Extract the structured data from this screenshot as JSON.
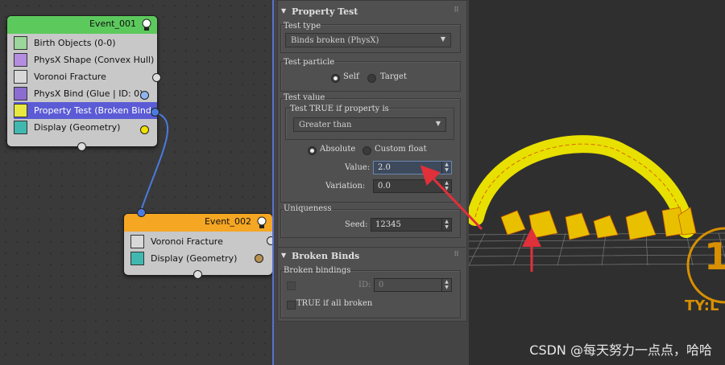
{
  "event1": {
    "title": "Event_001",
    "operators": [
      {
        "label": "Birth Objects (0-0)",
        "icon": "birth-objects-icon"
      },
      {
        "label": "PhysX Shape (Convex Hull)",
        "icon": "physx-shape-icon"
      },
      {
        "label": "Voronoi Fracture",
        "icon": "voronoi-fracture-icon"
      },
      {
        "label": "PhysX Bind (Glue | ID: 0)",
        "icon": "physx-bind-icon"
      },
      {
        "label": "Property Test (Broken Bind...",
        "icon": "property-test-icon"
      },
      {
        "label": "Display (Geometry)",
        "icon": "display-geometry-icon"
      }
    ]
  },
  "event2": {
    "title": "Event_002",
    "operators": [
      {
        "label": "Voronoi Fracture",
        "icon": "voronoi-fracture-icon"
      },
      {
        "label": "Display (Geometry)",
        "icon": "display-geometry-icon"
      }
    ]
  },
  "panel": {
    "rollout1": "Property Test",
    "test_type_label": "Test type",
    "test_type_value": "Binds broken (PhysX)",
    "test_particle_label": "Test particle",
    "self_label": "Self",
    "target_label": "Target",
    "test_value_label": "Test value",
    "test_true_label": "Test TRUE if property is",
    "compare_value": "Greater than",
    "absolute_label": "Absolute",
    "custom_float_label": "Custom float",
    "value_label": "Value:",
    "value_value": "2.0",
    "variation_label": "Variation:",
    "variation_value": "0.0",
    "uniqueness_label": "Uniqueness",
    "seed_label": "Seed:",
    "seed_value": "12345",
    "rollout2": "Broken Binds",
    "broken_bindings_label": "Broken bindings",
    "id_label": "ID:",
    "id_value": "0",
    "true_all_label": "TRUE if all broken"
  },
  "viewport": {
    "logo_text": "TY:L",
    "logo_digit": "1",
    "watermark": "CSDN @每天努力一点点，哈哈"
  },
  "colors": {
    "event1_header": "#5cc95c",
    "event2_header": "#f5a623",
    "selection": "#5b5bd6",
    "wire": "#4a7be0",
    "arrow": "#e0303a",
    "geometry": "#e8e000"
  }
}
